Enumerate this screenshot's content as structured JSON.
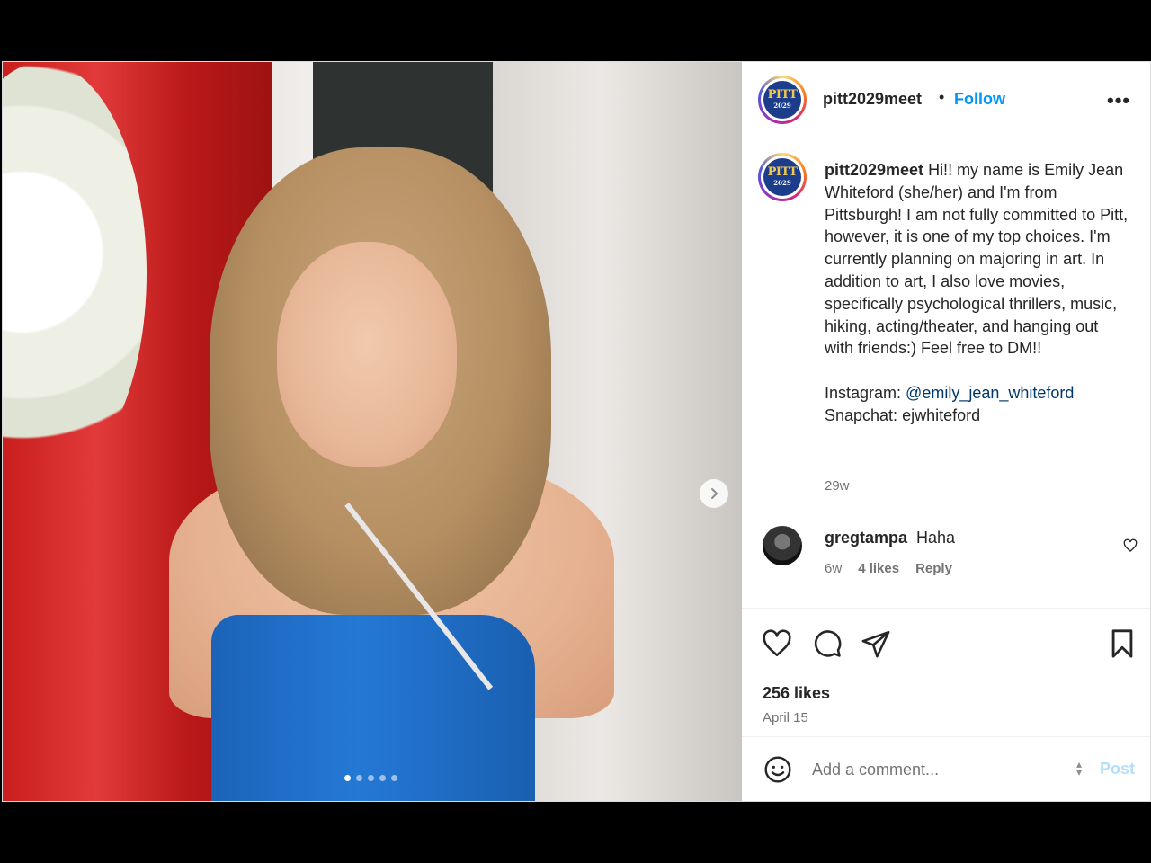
{
  "post": {
    "author": "pitt2029meet",
    "separator": "•",
    "follow_label": "Follow",
    "more_label": "•••",
    "avatar_logo_line1": "PITT",
    "avatar_logo_line2": "2029",
    "caption_username": "pitt2029meet",
    "caption_text": " Hi!! my name is Emily Jean Whiteford (she/her) and I'm from Pittsburgh! I am not fully committed to Pitt, however, it is one of my top choices. I'm currently planning on majoring in art. In addition to art, I also love movies, specifically psychological thrillers, music, hiking, acting/theater, and hanging out with friends:) Feel free to DM!!\n\nInstagram: ",
    "caption_mention": "@emily_jean_whiteford",
    "caption_tail": "\nSnapchat: ejwhiteford",
    "caption_time": "29w",
    "carousel_dots": 5,
    "carousel_active": 0
  },
  "comments": [
    {
      "username": "gregtampa",
      "text": "Haha",
      "time": "6w",
      "likes": "4 likes",
      "reply_label": "Reply"
    }
  ],
  "actions": {
    "likes": "256 likes",
    "date": "April 15"
  },
  "composer": {
    "placeholder": "Add a comment...",
    "post_label": "Post"
  },
  "colors": {
    "link": "#0095f6",
    "mention": "#00376b",
    "post_disabled": "#b2dffc"
  }
}
